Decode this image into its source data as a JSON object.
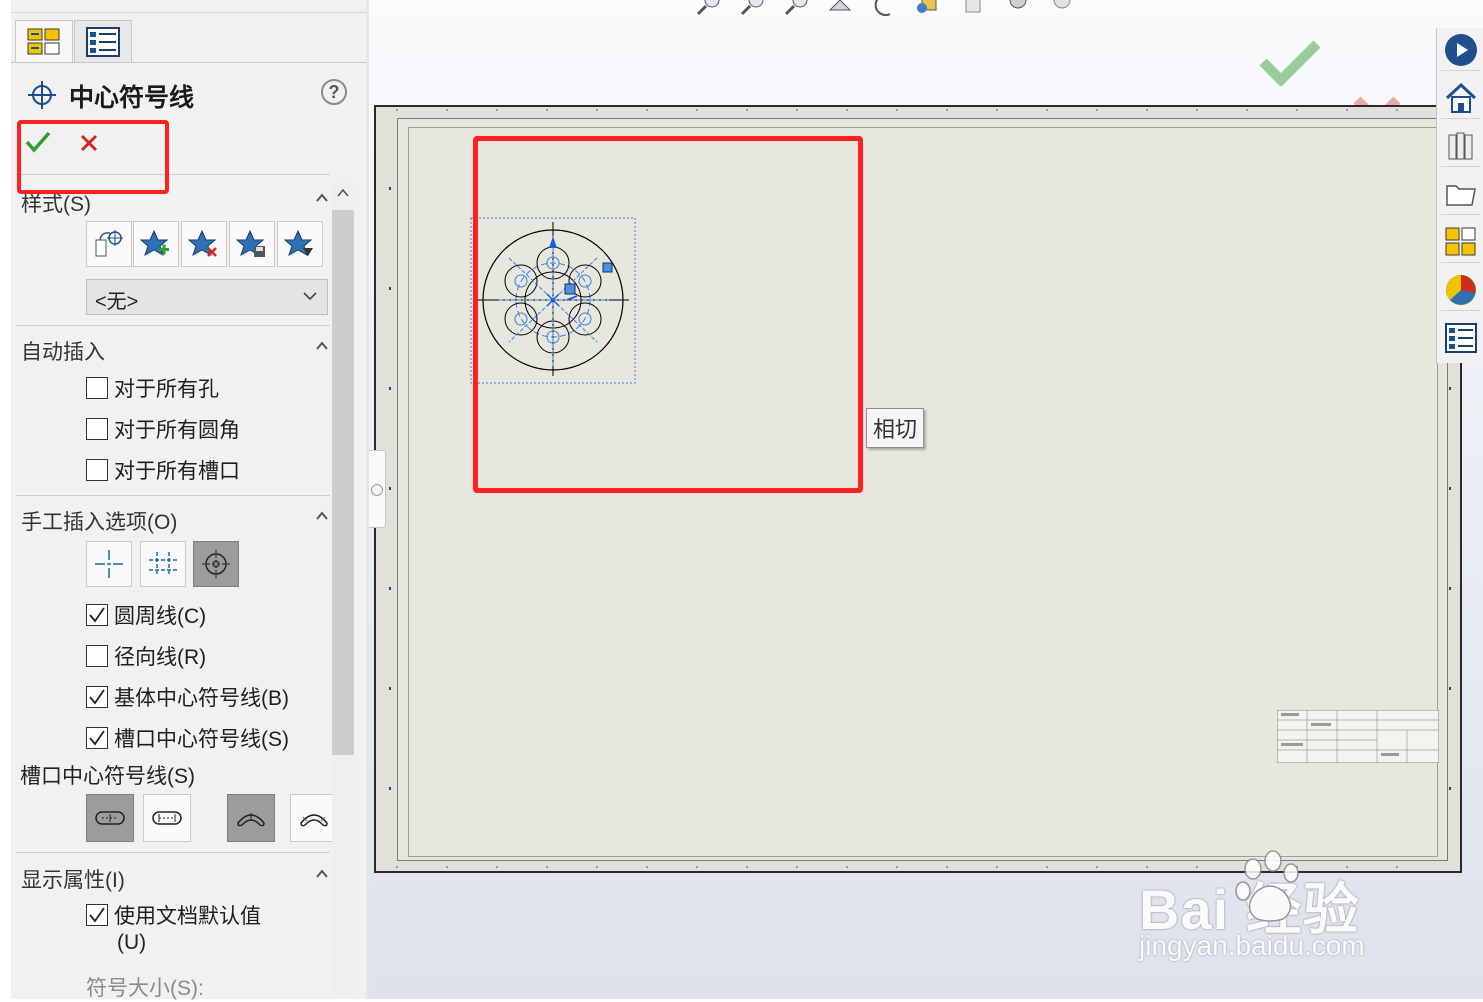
{
  "property_manager": {
    "title": "中心符号线",
    "help_label": "?",
    "sections": {
      "style": {
        "label": "样式(S)",
        "selected": "<无>"
      },
      "auto_insert": {
        "label": "自动插入",
        "items": [
          {
            "label": "对于所有孔",
            "checked": false
          },
          {
            "label": "对于所有圆角",
            "checked": false
          },
          {
            "label": "对于所有槽口",
            "checked": false
          }
        ]
      },
      "manual_insert": {
        "label": "手工插入选项(O)",
        "items": [
          {
            "label": "圆周线(C)",
            "checked": true
          },
          {
            "label": "径向线(R)",
            "checked": false
          },
          {
            "label": "基体中心符号线(B)",
            "checked": true
          },
          {
            "label": "槽口中心符号线(S)",
            "checked": true
          }
        ]
      },
      "slot_center_marks": {
        "label": "槽口中心符号线(S)"
      },
      "display_attributes": {
        "label": "显示属性(I)",
        "use_doc_default": {
          "label": "使用文档默认值",
          "shortcut": "(U)",
          "checked": true
        },
        "mark_size_label": "符号大小(S):"
      }
    }
  },
  "graphics": {
    "tooltip": "相切"
  },
  "watermark": {
    "brand": "Bai  经验",
    "url": "jingyan.baidu.com"
  },
  "colors": {
    "highlight_red": "#ff2020",
    "ok_green": "#2e9e2e",
    "cancel_red": "#d42a1e",
    "sheet": "#e7e6dc",
    "sketch_blue": "#1a5fe0"
  }
}
